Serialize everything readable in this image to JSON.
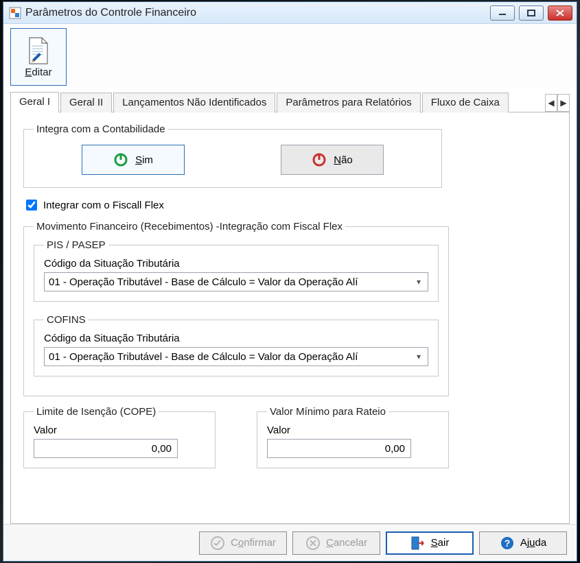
{
  "window": {
    "title": "Parâmetros do Controle Financeiro"
  },
  "toolbar": {
    "edit": {
      "label": "Editar",
      "underline_index": 0
    }
  },
  "tabs": {
    "items": [
      {
        "label": "Geral I"
      },
      {
        "label": "Geral II"
      },
      {
        "label": "Lançamentos Não Identificados"
      },
      {
        "label": "Parâmetros para Relatórios"
      },
      {
        "label": "Fluxo de Caixa"
      }
    ],
    "active_index": 0
  },
  "groups": {
    "integra_contab": {
      "legend": "Integra com a Contabilidade",
      "sim_label": "Sim",
      "nao_label": "Não"
    },
    "fiscal_checkbox": {
      "label": "Integrar com o Fiscall Flex",
      "checked": true
    },
    "mov_fin": {
      "legend": "Movimento Financeiro (Recebimentos) -Integração com Fiscal Flex",
      "pis": {
        "legend": "PIS / PASEP",
        "field_label": "Código da Situação Tributária",
        "value": "01 - Operação Tributável - Base de Cálculo = Valor da Operação Alí"
      },
      "cofins": {
        "legend": "COFINS",
        "field_label": "Código da Situação Tributária",
        "value": "01 - Operação Tributável - Base de Cálculo = Valor da Operação Alí"
      }
    },
    "limite_isencao": {
      "legend": "Limite de Isenção (COPE)",
      "field_label": "Valor",
      "value": "0,00"
    },
    "valor_min_rateio": {
      "legend": "Valor Mínimo para Rateio",
      "field_label": "Valor",
      "value": "0,00"
    }
  },
  "buttons": {
    "confirmar": "Confirmar",
    "cancelar": "Cancelar",
    "sair": "Sair",
    "ajuda": "Ajuda"
  }
}
